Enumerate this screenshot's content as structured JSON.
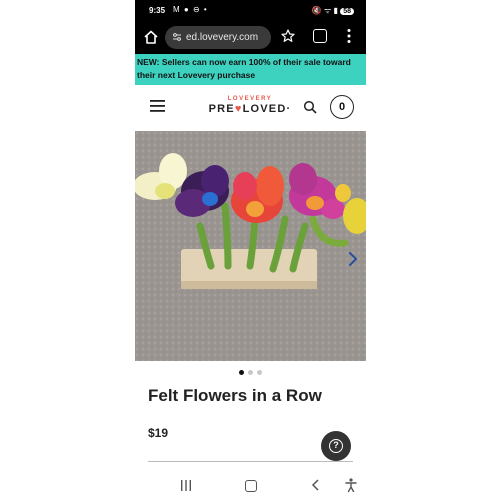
{
  "status_bar": {
    "time": "9:35",
    "left_icons": "M ● ⊖ •",
    "right_icons": "🔇 ᯤ ▮",
    "battery": "58"
  },
  "browser": {
    "url": "ed.lovevery.com",
    "icons": [
      "home-icon",
      "site-settings-icon",
      "bookmark-star-icon",
      "tabs-icon",
      "more-menu-icon"
    ]
  },
  "banner": {
    "text": "NEW: Sellers can now earn 100% of their sale toward their next Lovevery purchase"
  },
  "header": {
    "logo_top": "LOVEVERY",
    "logo_pre": "PRE",
    "logo_heart": "♥",
    "logo_post": "LOVED",
    "logo_mark": "·",
    "cart_count": "0"
  },
  "gallery": {
    "image_alt": "Felt flowers standing in a wooden block on carpet",
    "dots": 3,
    "active_dot": 0
  },
  "product": {
    "title": "Felt Flowers in a Row",
    "price": "$19"
  },
  "help": {
    "glyph": "?"
  },
  "colors": {
    "banner": "#3dd1c0",
    "brand_heart": "#e8584b",
    "dark": "#222222"
  }
}
